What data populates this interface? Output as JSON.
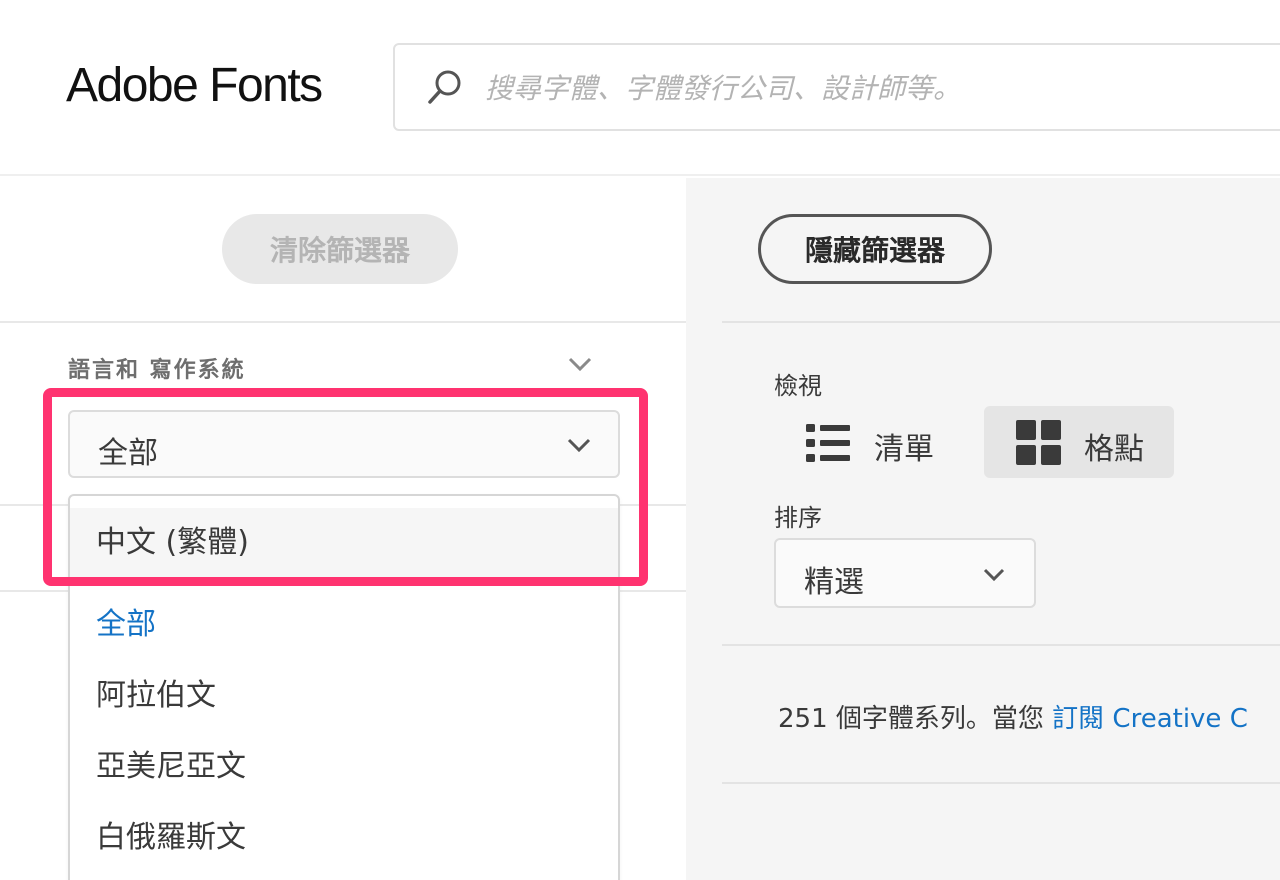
{
  "header": {
    "logo": "Adobe Fonts",
    "search_placeholder": "搜尋字體、字體發行公司、設計師等。"
  },
  "filters": {
    "clear_label": "清除篩選器",
    "language_section_label": "語言和 寫作系統",
    "language_selected": "全部",
    "dropdown_items": [
      "中文 (繁體)",
      "全部",
      "阿拉伯文",
      "亞美尼亞文",
      "白俄羅斯文"
    ]
  },
  "results": {
    "hide_label": "隱藏篩選器",
    "view_label": "檢視",
    "view_list_label": "清單",
    "view_grid_label": "格點",
    "sort_label": "排序",
    "sort_value": "精選",
    "count_text": "251 個字體系列。當您 ",
    "count_link": "訂閱 Creative C"
  },
  "colors": {
    "highlight": "#ff3370",
    "link": "#1473c6"
  }
}
